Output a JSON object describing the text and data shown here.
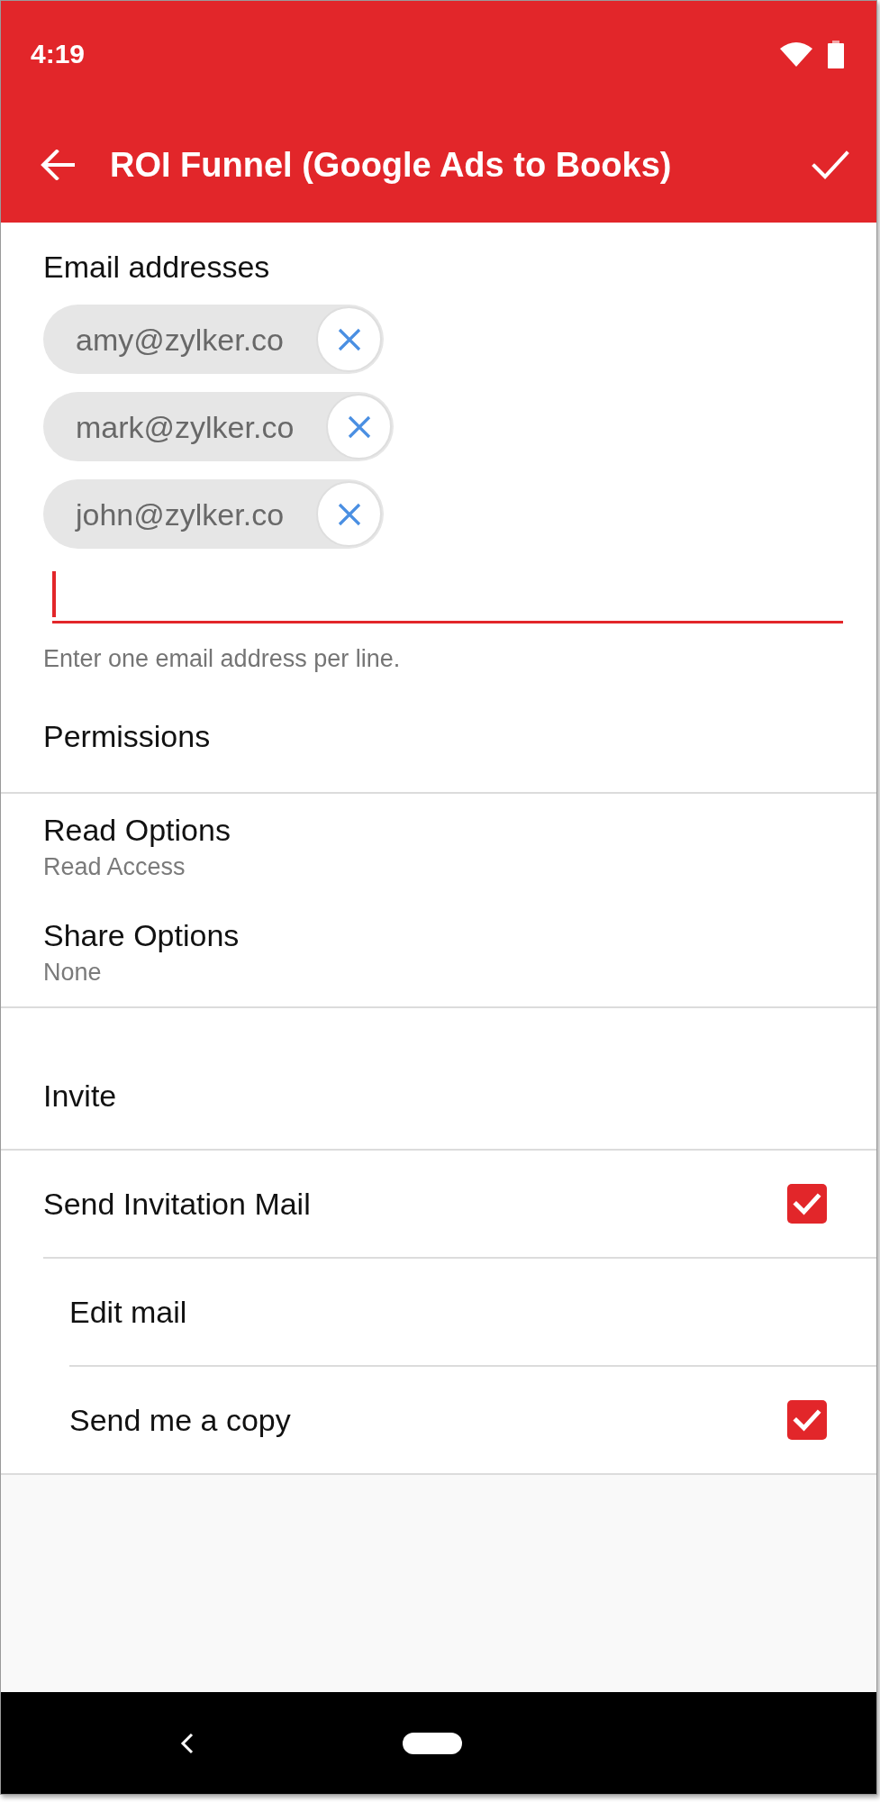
{
  "status_bar": {
    "time": "4:19"
  },
  "app_bar": {
    "title": "ROI Funnel (Google Ads to Books)"
  },
  "email_addresses": {
    "label": "Email addresses",
    "chips": [
      {
        "address": "amy@zylker.co"
      },
      {
        "address": "mark@zylker.co"
      },
      {
        "address": "john@zylker.co"
      }
    ],
    "input": {
      "focused": true
    },
    "helper": "Enter one email address per line."
  },
  "permissions": {
    "heading": "Permissions",
    "options": [
      {
        "label": "Read Options",
        "value": "Read Access"
      },
      {
        "label": "Share Options",
        "value": "None"
      }
    ]
  },
  "invite": {
    "heading": "Invite",
    "items": [
      {
        "kind": "checkbox",
        "label": "Send Invitation Mail",
        "checked": true,
        "children": [
          {
            "kind": "link",
            "label": "Edit mail"
          },
          {
            "kind": "checkbox",
            "label": "Send me a copy",
            "checked": true
          }
        ]
      }
    ]
  }
}
